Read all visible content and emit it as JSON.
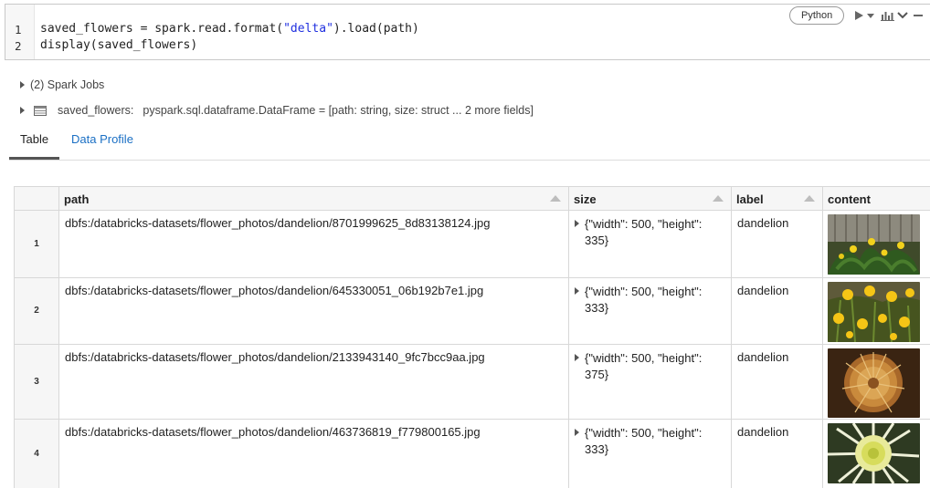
{
  "code_cell": {
    "line_numbers": [
      "1",
      "2"
    ],
    "line1_pre": "saved_flowers = spark.read.format(",
    "line1_str": "\"delta\"",
    "line1_post": ").load(path)",
    "line2": "display(saved_flowers)",
    "language": "Python",
    "icons": [
      "run-icon",
      "run-dropdown-icon",
      "chart-icon",
      "collapse-icon",
      "minimize-icon"
    ]
  },
  "output": {
    "spark_jobs": "(2) Spark Jobs",
    "df_name": "saved_flowers:",
    "df_type": "pyspark.sql.dataframe.DataFrame = [path: string, size: struct ... 2 more fields]"
  },
  "tabs": [
    {
      "label": "Table",
      "active": true
    },
    {
      "label": "Data Profile",
      "active": false
    }
  ],
  "table": {
    "columns": [
      "path",
      "size",
      "label",
      "content"
    ],
    "rows": [
      {
        "index": "1",
        "path": "dbfs:/databricks-datasets/flower_photos/dandelion/8701999625_8d83138124.jpg",
        "size": "{\"width\": 500, \"height\": 335}",
        "label": "dandelion",
        "image": "dandelion-plant-by-fence"
      },
      {
        "index": "2",
        "path": "dbfs:/databricks-datasets/flower_photos/dandelion/645330051_06b192b7e1.jpg",
        "size": "{\"width\": 500, \"height\": 333}",
        "label": "dandelion",
        "image": "yellow-dandelions-field"
      },
      {
        "index": "3",
        "path": "dbfs:/databricks-datasets/flower_photos/dandelion/2133943140_9fc7bcc9aa.jpg",
        "size": "{\"width\": 500, \"height\": 375}",
        "label": "dandelion",
        "image": "dandelion-seed-head"
      },
      {
        "index": "4",
        "path": "dbfs:/databricks-datasets/flower_photos/dandelion/463736819_f779800165.jpg",
        "size": "{\"width\": 500, \"height\": 333}",
        "label": "dandelion",
        "image": "dandelion-flower-closeup"
      }
    ]
  },
  "colors": {
    "accent_link": "#1a6fc4",
    "string_literal": "#1f2fdf",
    "header_bg": "#f6f6f6",
    "border": "#d8d8d8"
  }
}
